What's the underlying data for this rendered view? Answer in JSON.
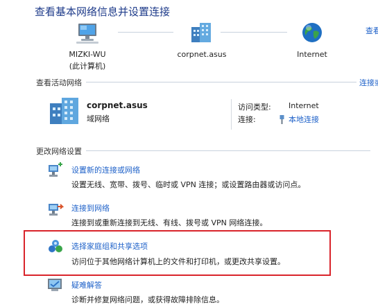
{
  "header": {
    "title": "查看基本网络信息并设置连接",
    "view_full_map_partial": "查看"
  },
  "network_map": {
    "nodes": [
      {
        "label": "MIZKI-WU",
        "sub": "(此计算机)",
        "icon": "computer-icon"
      },
      {
        "label": "corpnet.asus",
        "icon": "building-icon"
      },
      {
        "label": "Internet",
        "icon": "globe-icon"
      }
    ]
  },
  "active": {
    "section_label": "查看活动网络",
    "connect_disconnect_partial": "连接或",
    "network_name": "corpnet.asus",
    "network_type": "域网络",
    "access_type_label": "访问类型:",
    "access_type_value": "Internet",
    "connection_label": "连接:",
    "connection_value": "本地连接",
    "connection_icon": "ethernet-icon"
  },
  "change": {
    "section_label": "更改网络设置",
    "options": [
      {
        "icon": "new-connection-icon",
        "title": "设置新的连接或网络",
        "desc": "设置无线、宽带、拨号、临时或 VPN 连接；或设置路由器或访问点。"
      },
      {
        "icon": "connect-network-icon",
        "title": "连接到网络",
        "desc": "连接到或重新连接到无线、有线、拨号或 VPN 网络连接。"
      },
      {
        "icon": "homegroup-icon",
        "title": "选择家庭组和共享选项",
        "desc": "访问位于其他网络计算机上的文件和打印机，或更改共享设置。"
      },
      {
        "icon": "troubleshoot-icon",
        "title": "疑难解答",
        "desc": "诊断并修复网络问题，或获得故障排除信息。"
      }
    ]
  },
  "colors": {
    "link": "#1f62c9",
    "title": "#1e3b8a",
    "highlight": "#d9232a"
  }
}
